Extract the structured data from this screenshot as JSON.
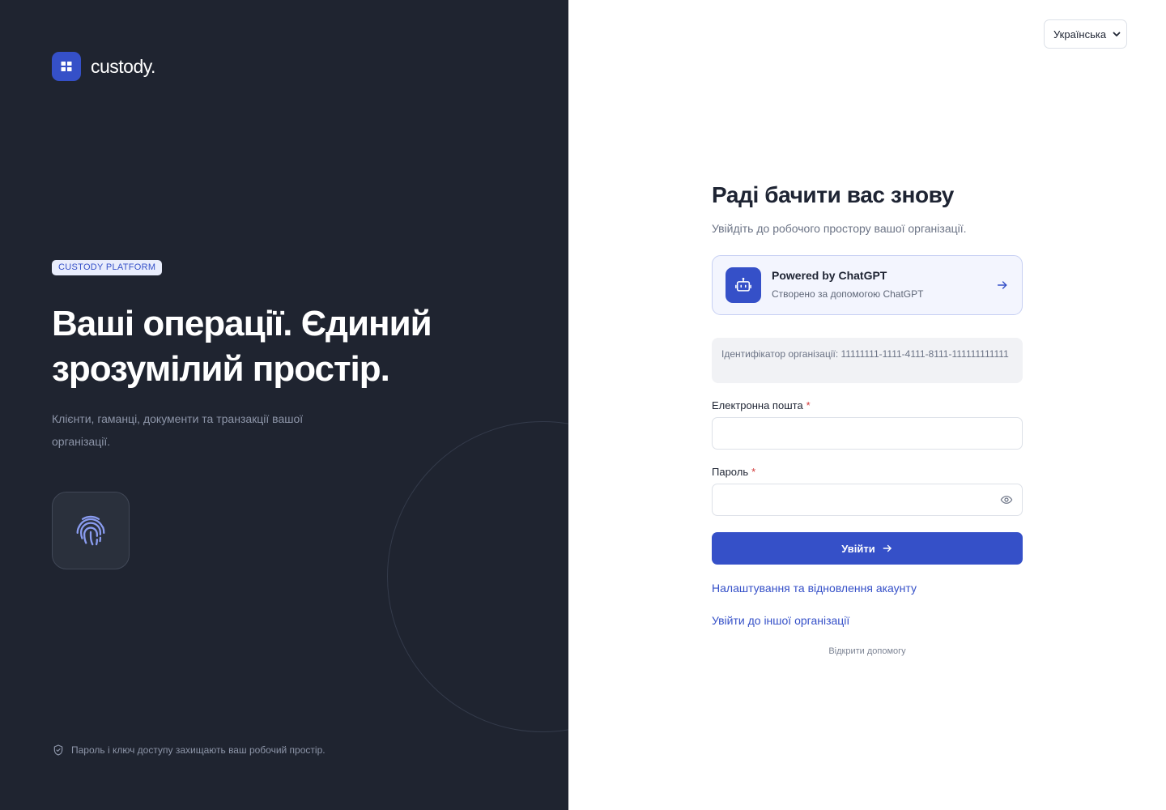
{
  "brand": {
    "name": "custody.",
    "icon": "grid-logo-icon"
  },
  "hero": {
    "badge": "CUSTODY PLATFORM",
    "headline": "Ваші операції. Єдиний зрозумілий простір.",
    "subtext": "Клієнти, гаманці, документи та транзакції вашої організації.",
    "icon": "fingerprint-icon"
  },
  "footer": {
    "note": "Пароль і ключ доступу захищають ваш робочий простір.",
    "icon": "shield-check-icon"
  },
  "language": {
    "selected": "Українська"
  },
  "login": {
    "title": "Раді бачити вас знову",
    "subtitle": "Увійдіть до робочого простору вашої організації.",
    "gpt_card": {
      "title": "Powered by ChatGPT",
      "subtitle": "Створено за допомогою ChatGPT",
      "icon": "robot-icon"
    },
    "org_id": "Ідентифікатор організації: 11111111-1111-4111-8111-111111111111",
    "email_label": "Електронна пошта",
    "email_value": "",
    "password_label": "Пароль",
    "password_value": "",
    "required_mark": "*",
    "submit_label": "Увійти",
    "link_recovery": "Налаштування та відновлення акаунту",
    "link_other_org": "Увійти до іншої організації",
    "help": "Відкрити допомогу"
  },
  "colors": {
    "accent": "#3550c8",
    "left_bg": "#1f2430",
    "text": "#1e2433"
  }
}
